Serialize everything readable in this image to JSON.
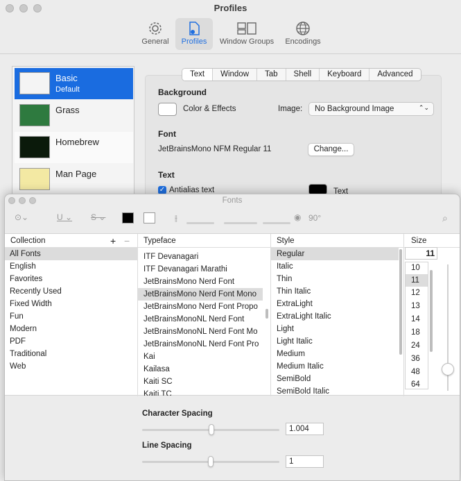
{
  "window": {
    "title": "Profiles"
  },
  "toolbar": {
    "items": [
      {
        "label": "General",
        "icon": "gear-icon"
      },
      {
        "label": "Profiles",
        "icon": "profile-document-icon"
      },
      {
        "label": "Window Groups",
        "icon": "window-groups-icon"
      },
      {
        "label": "Encodings",
        "icon": "globe-icon"
      }
    ],
    "selected": "Profiles"
  },
  "profiles": [
    {
      "name": "Basic",
      "subtitle": "Default"
    },
    {
      "name": "Grass"
    },
    {
      "name": "Homebrew"
    },
    {
      "name": "Man Page"
    }
  ],
  "tabs": [
    "Text",
    "Window",
    "Tab",
    "Shell",
    "Keyboard",
    "Advanced"
  ],
  "settings": {
    "background_heading": "Background",
    "color_effects_label": "Color & Effects",
    "image_label": "Image:",
    "image_value": "No Background Image",
    "font_heading": "Font",
    "font_value": "JetBrainsMono NFM Regular 11",
    "change_button": "Change...",
    "text_heading": "Text",
    "antialias_label": "Antialias text",
    "text_color_label": "Text"
  },
  "fonts_panel": {
    "title": "Fonts",
    "rotation": "90°",
    "columns": {
      "collection": "Collection",
      "typeface": "Typeface",
      "style": "Style",
      "size": "Size"
    },
    "collections": [
      "All Fonts",
      "English",
      "Favorites",
      "Recently Used",
      "Fixed Width",
      "Fun",
      "Modern",
      "PDF",
      "Traditional",
      "Web"
    ],
    "typefaces": [
      "ITF Devanagari",
      "ITF Devanagari Marathi",
      "JetBrainsMono Nerd Font",
      "JetBrainsMono Nerd Font Mono",
      "JetBrainsMono Nerd Font Propo",
      "JetBrainsMonoNL Nerd Font",
      "JetBrainsMonoNL Nerd Font Mo",
      "JetBrainsMonoNL Nerd Font Pro",
      "Kai",
      "Kailasa",
      "Kaiti SC",
      "Kaiti TC"
    ],
    "styles": [
      "Regular",
      "Italic",
      "Thin",
      "Thin Italic",
      "ExtraLight",
      "ExtraLight Italic",
      "Light",
      "Light Italic",
      "Medium",
      "Medium Italic",
      "SemiBold",
      "SemiBold Italic"
    ],
    "size_value": "11",
    "sizes": [
      "10",
      "11",
      "12",
      "13",
      "14",
      "18",
      "24",
      "36",
      "48",
      "64"
    ],
    "character_spacing_label": "Character Spacing",
    "character_spacing_value": "1.004",
    "line_spacing_label": "Line Spacing",
    "line_spacing_value": "1"
  }
}
